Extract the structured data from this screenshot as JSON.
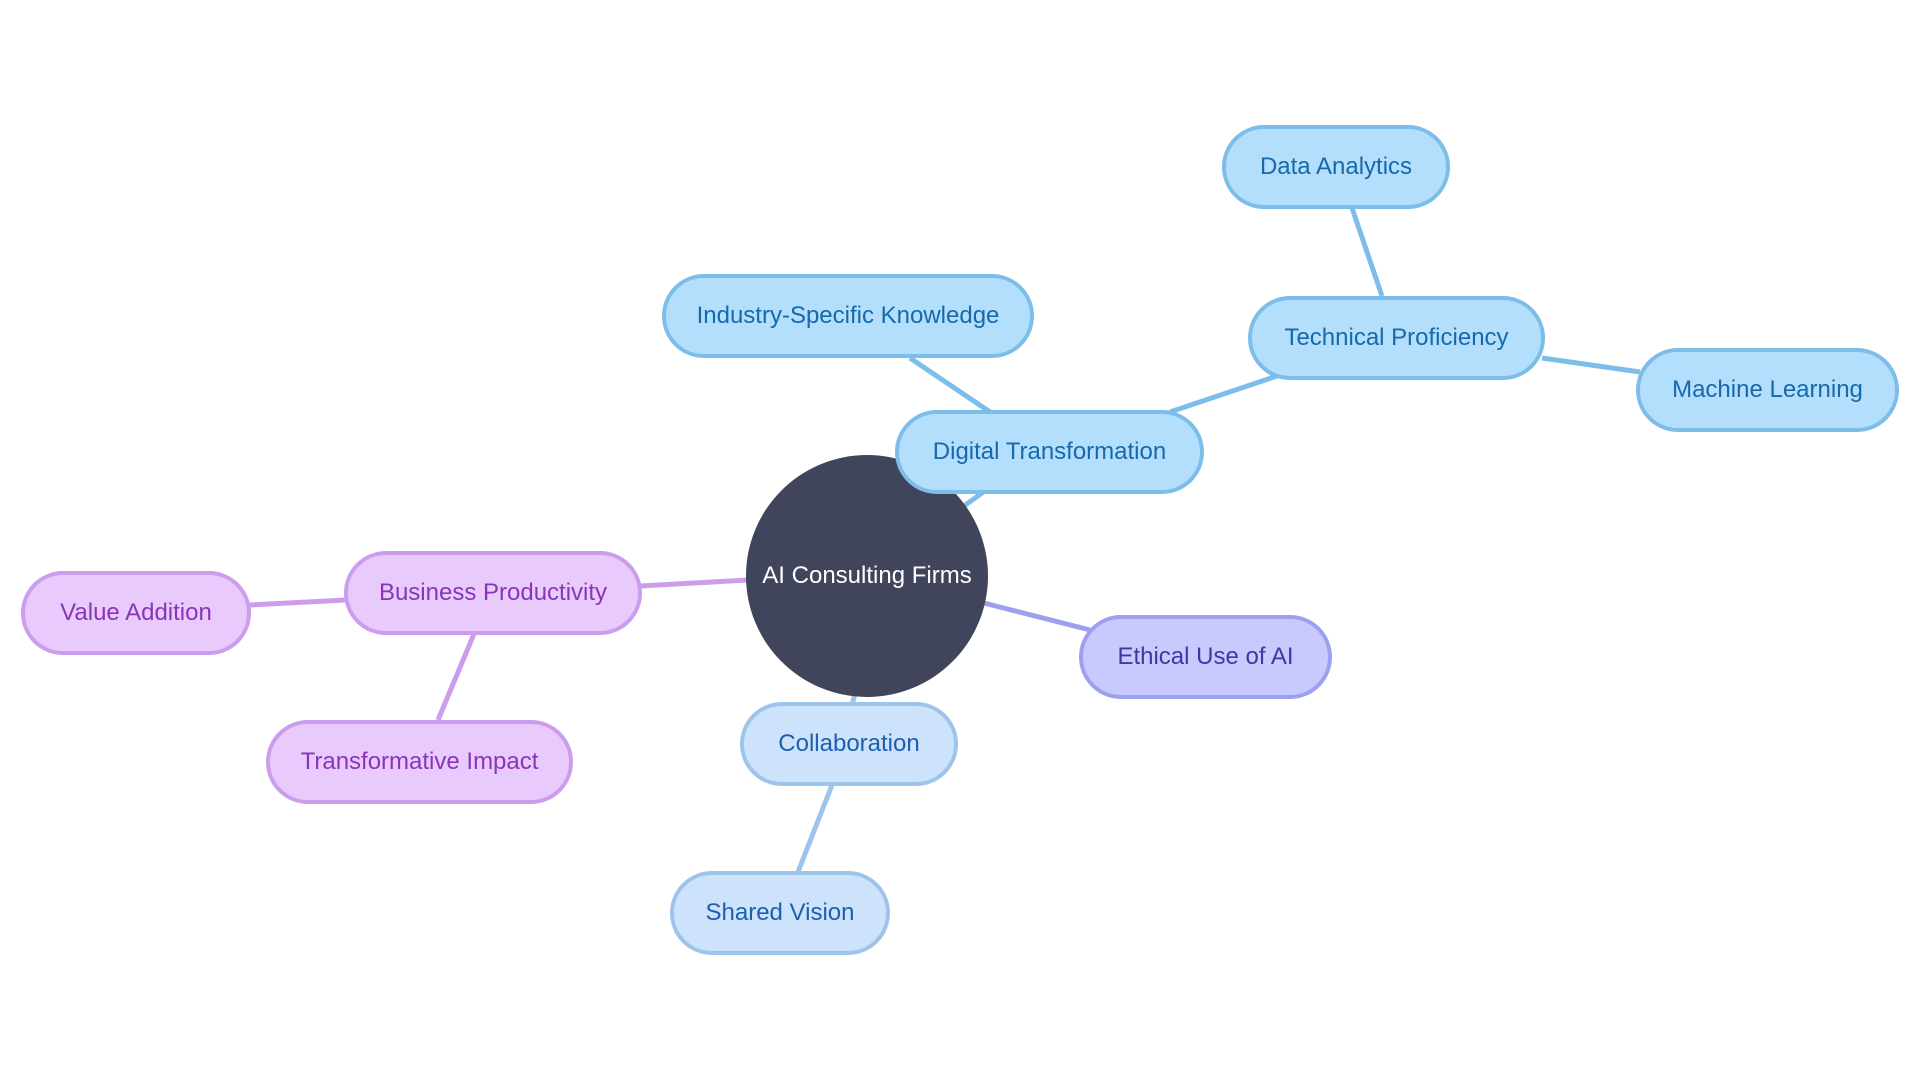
{
  "diagram": {
    "type": "mindmap",
    "root": {
      "id": "root",
      "label": "AI Consulting Firms",
      "color": "#41455c"
    },
    "nodes": [
      {
        "id": "digital",
        "label": "Digital Transformation",
        "parent": "root",
        "theme": "blue"
      },
      {
        "id": "industry",
        "label": "Industry-Specific Knowledge",
        "parent": "digital",
        "theme": "blue"
      },
      {
        "id": "technical",
        "label": "Technical Proficiency",
        "parent": "digital",
        "theme": "blue"
      },
      {
        "id": "data",
        "label": "Data Analytics",
        "parent": "technical",
        "theme": "blue"
      },
      {
        "id": "ml",
        "label": "Machine Learning",
        "parent": "technical",
        "theme": "blue"
      },
      {
        "id": "ethical",
        "label": "Ethical Use of AI",
        "parent": "root",
        "theme": "violet"
      },
      {
        "id": "collab",
        "label": "Collaboration",
        "parent": "root",
        "theme": "lightblue"
      },
      {
        "id": "shared",
        "label": "Shared Vision",
        "parent": "collab",
        "theme": "lightblue"
      },
      {
        "id": "business",
        "label": "Business Productivity",
        "parent": "root",
        "theme": "purple"
      },
      {
        "id": "value",
        "label": "Value Addition",
        "parent": "business",
        "theme": "purple"
      },
      {
        "id": "transform",
        "label": "Transformative Impact",
        "parent": "business",
        "theme": "purple"
      }
    ],
    "theme_colors": {
      "blue": {
        "fill": "#b3dffd",
        "stroke": "#7dbde9",
        "text": "#1769aa"
      },
      "lightblue": {
        "fill": "#cde3fb",
        "stroke": "#9ec4ec",
        "text": "#1d5fb0"
      },
      "violet": {
        "fill": "#c8cafd",
        "stroke": "#9da0ee",
        "text": "#3a3aa6"
      },
      "purple": {
        "fill": "#e8cafd",
        "stroke": "#cc9ced",
        "text": "#8a35b8"
      }
    }
  }
}
